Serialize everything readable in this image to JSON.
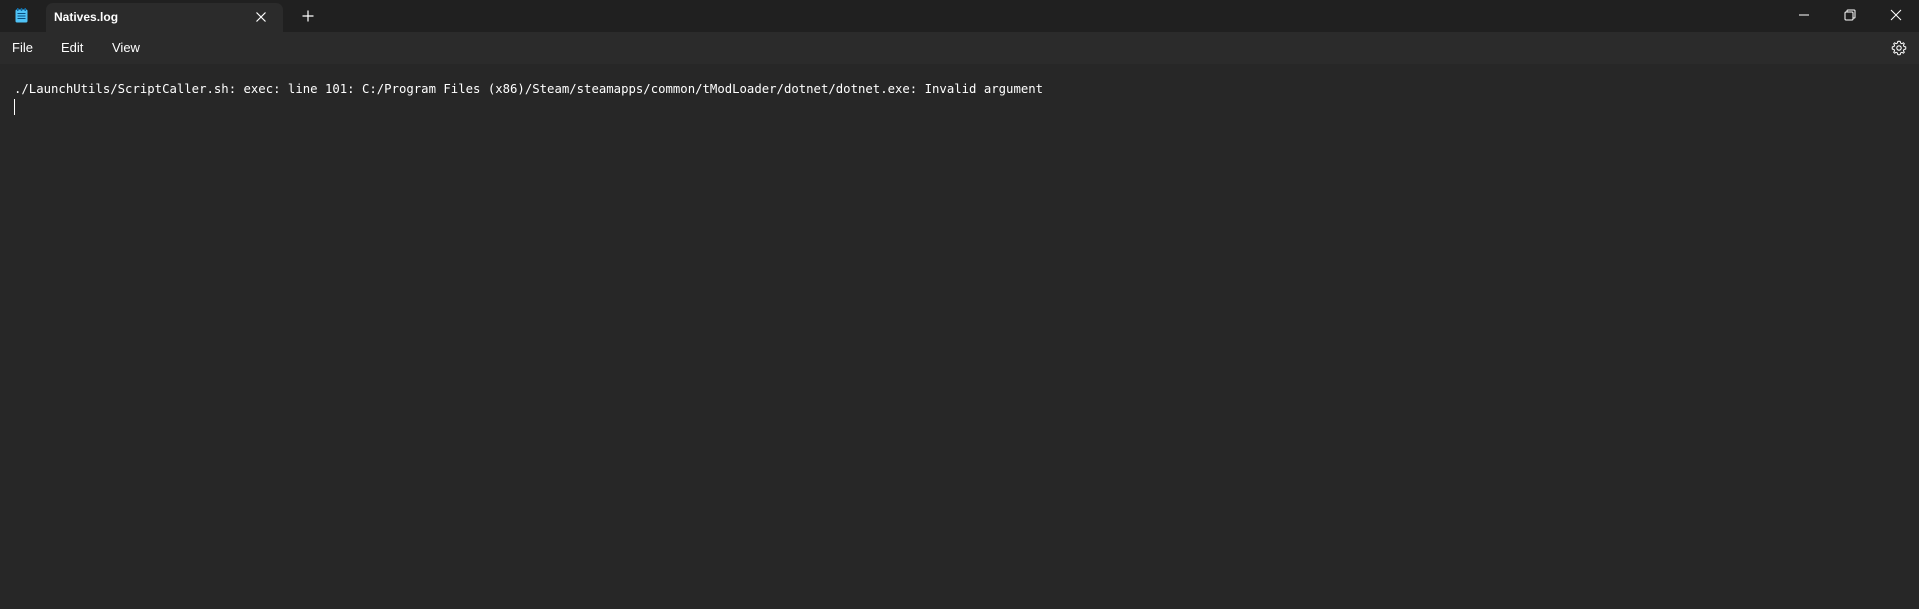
{
  "titlebar": {
    "app_icon": "notepad-icon",
    "tab": {
      "title": "Natives.log",
      "close_icon": "close-icon"
    },
    "new_tab_icon": "plus-icon",
    "window_controls": [
      "minimize-icon",
      "restore-icon",
      "close-icon"
    ]
  },
  "menubar": {
    "items": [
      "File",
      "Edit",
      "View"
    ],
    "settings_icon": "gear-icon"
  },
  "editor": {
    "lines": [
      "./LaunchUtils/ScriptCaller.sh: exec: line 101: C:/Program Files (x86)/Steam/steamapps/common/tModLoader/dotnet/dotnet.exe: Invalid argument"
    ]
  },
  "colors": {
    "titlebar_bg": "#202020",
    "menubar_bg": "#2b2b2b",
    "editor_bg": "#272727",
    "text": "#ffffff",
    "icon_accent": "#4fc3f7"
  }
}
